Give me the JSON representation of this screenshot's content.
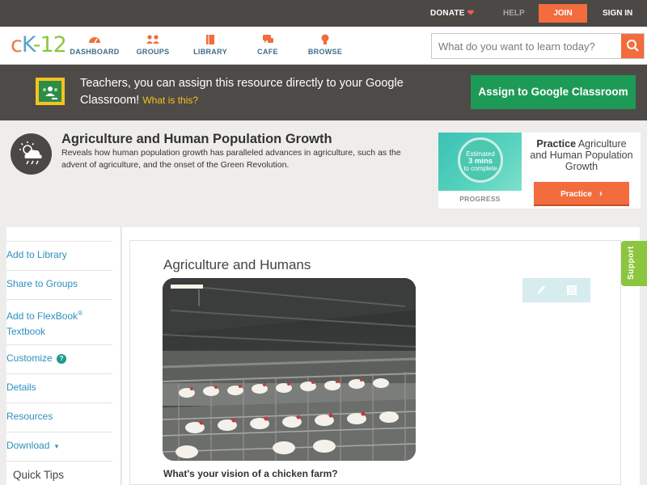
{
  "topbar": {
    "donate": "DONATE",
    "help": "HELP",
    "join": "JOIN",
    "sign_in": "SIGN IN"
  },
  "logo": {
    "c": "c",
    "k": "K",
    "dash": "-",
    "num": "12"
  },
  "nav": {
    "items": [
      {
        "label": "DASHBOARD",
        "icon": "dashboard-gauge-icon"
      },
      {
        "label": "GROUPS",
        "icon": "groups-people-icon"
      },
      {
        "label": "LIBRARY",
        "icon": "library-book-icon"
      },
      {
        "label": "CAFE",
        "icon": "cafe-chat-icon"
      },
      {
        "label": "BROWSE",
        "icon": "browse-bulb-icon"
      }
    ],
    "search_placeholder": "What do you want to learn today?"
  },
  "banner": {
    "text": "Teachers, you can assign this resource directly to your Google Classroom!",
    "what_is_this": "What is this?",
    "assign_button": "Assign to Google Classroom"
  },
  "concept": {
    "title": "Agriculture and Human Population Growth",
    "description": "Reveals how human population growth has paralleled advances in agriculture, such as the advent of agriculture, and the onset of the Green Revolution.",
    "icon": "weather-cloud-icon"
  },
  "practice_card": {
    "estimated_line1": "Estimated",
    "estimated_line2": "3 mins",
    "estimated_line3": "to complete",
    "progress_label": "PROGRESS",
    "practice_bold": "Practice",
    "practice_title": "Agriculture and Human Population Growth",
    "practice_button": "Practice"
  },
  "sidebar": {
    "add_to_library": "Add to Library",
    "share_to_groups": "Share to Groups",
    "add_to_flexbook": "Add to FlexBook",
    "registered": "®",
    "textbook": "Textbook",
    "customize": "Customize",
    "details": "Details",
    "resources": "Resources",
    "download": "Download",
    "download_caret": "▾",
    "quick_tips": "Quick Tips"
  },
  "content": {
    "section_title": "Agriculture and Humans",
    "caption": "What's your vision of a chicken farm?"
  },
  "support": "Support"
}
